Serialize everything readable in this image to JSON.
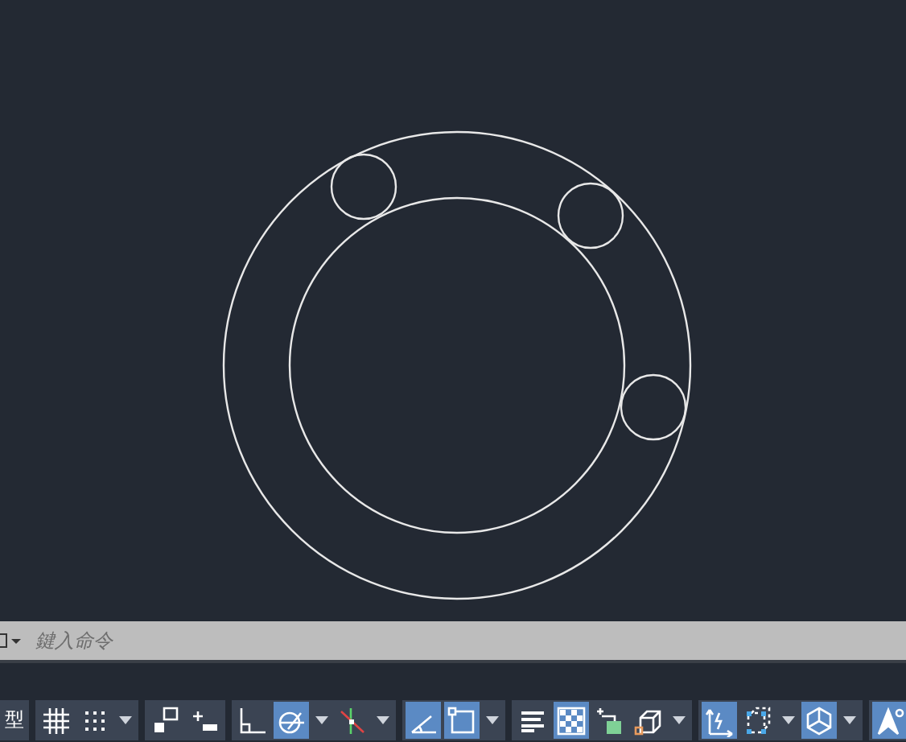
{
  "drawing": {
    "circles": [
      {
        "kind": "outer"
      },
      {
        "kind": "inner"
      },
      {
        "kind": "hole-a"
      },
      {
        "kind": "hole-b"
      },
      {
        "kind": "hole-c"
      }
    ]
  },
  "command_line": {
    "placeholder": "鍵入命令"
  },
  "status_bar": {
    "model_tab": "型",
    "groups": [
      [
        {
          "kind": "grid",
          "on": false
        },
        {
          "kind": "snap",
          "on": false
        },
        {
          "kind": "dropdown"
        }
      ],
      [
        {
          "kind": "infer",
          "on": false
        },
        {
          "kind": "dynin",
          "on": false
        }
      ],
      [
        {
          "kind": "ortho",
          "on": false
        },
        {
          "kind": "polar",
          "on": true
        },
        {
          "kind": "dropdown"
        },
        {
          "kind": "track",
          "on": false
        },
        {
          "kind": "dropdown"
        }
      ],
      [
        {
          "kind": "iso",
          "on": true
        },
        {
          "kind": "osnap",
          "on": true
        },
        {
          "kind": "dropdown"
        }
      ],
      [
        {
          "kind": "lwt",
          "on": false
        },
        {
          "kind": "transp",
          "on": true
        },
        {
          "kind": "cycle",
          "on": false
        },
        {
          "kind": "box3d",
          "on": false
        },
        {
          "kind": "dropdown"
        }
      ],
      [
        {
          "kind": "ucs",
          "on": true
        },
        {
          "kind": "filter",
          "on": false
        },
        {
          "kind": "dropdown"
        },
        {
          "kind": "gizmo",
          "on": true
        },
        {
          "kind": "dropdown"
        }
      ],
      [
        {
          "kind": "anno",
          "on": true
        }
      ]
    ]
  }
}
